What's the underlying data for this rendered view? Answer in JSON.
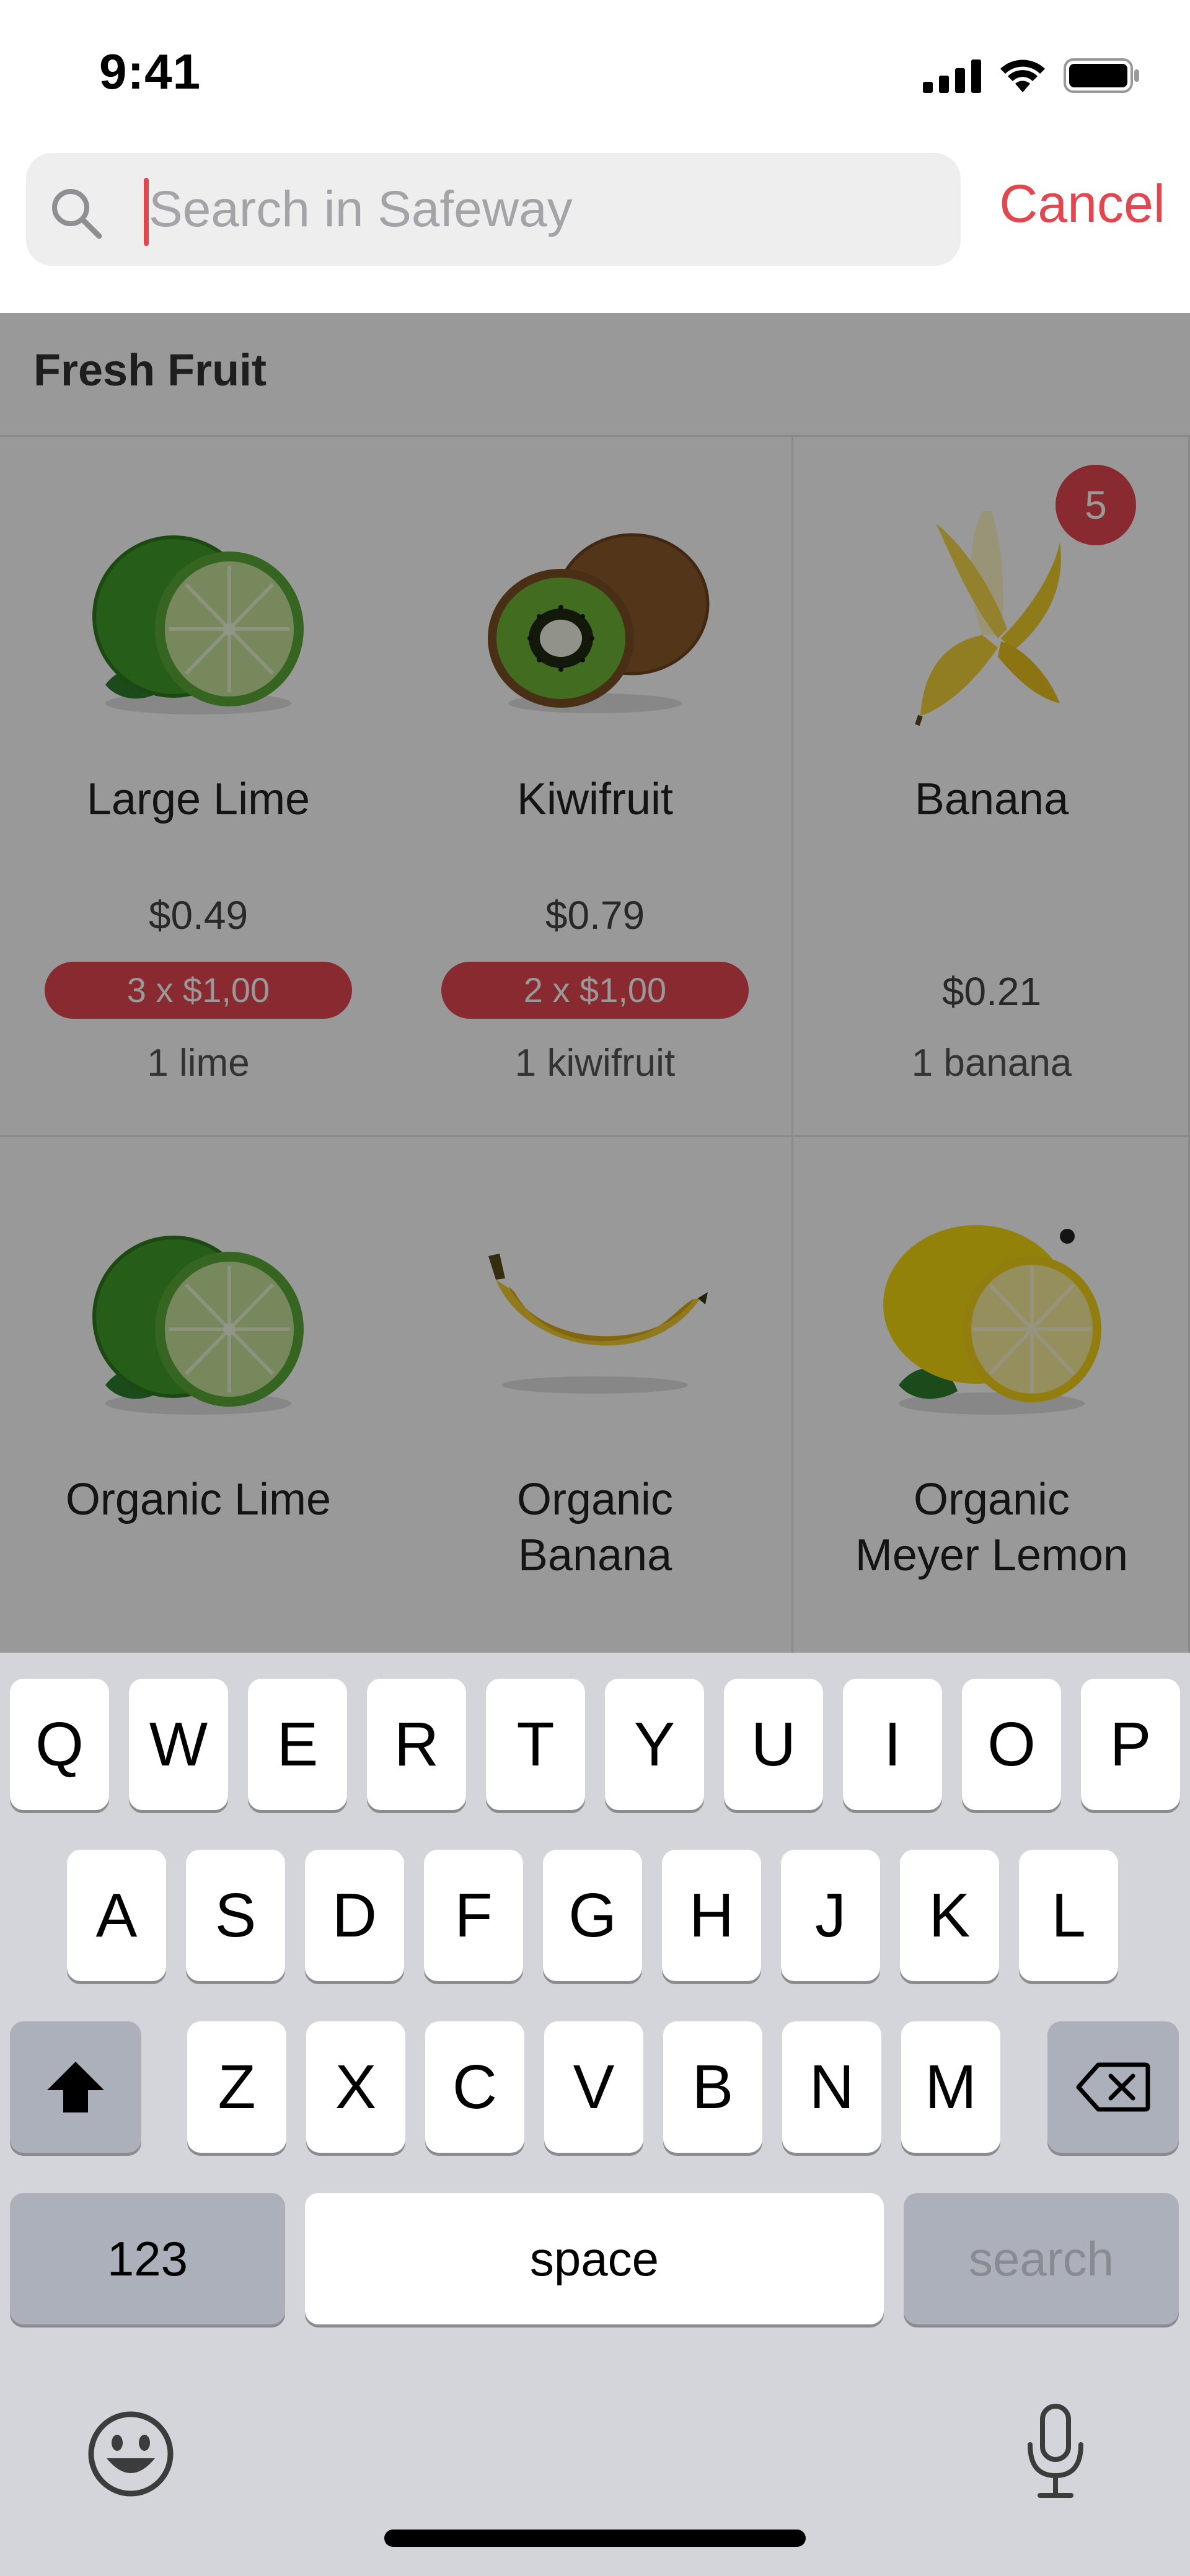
{
  "status_bar": {
    "time": "9:41",
    "icons": [
      "signal-icon",
      "wifi-icon",
      "battery-icon"
    ]
  },
  "search": {
    "placeholder": "Search in Safeway",
    "value": "",
    "cancel_label": "Cancel"
  },
  "section": {
    "title": "Fresh Fruit"
  },
  "products": [
    {
      "name": "Large Lime",
      "price": "$0.49",
      "promo": "3 x $1,00",
      "unit": "1 lime",
      "image": "lime-image"
    },
    {
      "name": "Kiwifruit",
      "price": "$0.79",
      "promo": "2 x $1,00",
      "unit": "1 kiwifruit",
      "image": "kiwi-image"
    },
    {
      "name": "Banana",
      "price": "$0.21",
      "promo": null,
      "unit": "1 banana",
      "image": "banana-image",
      "cart_count": "5"
    },
    {
      "name": "Organic Lime",
      "image": "lime-image"
    },
    {
      "name": "Organic\nBanana",
      "image": "banana-image"
    },
    {
      "name": "Organic\nMeyer Lemon",
      "image": "lemon-image"
    }
  ],
  "keyboard": {
    "row1": [
      "Q",
      "W",
      "E",
      "R",
      "T",
      "Y",
      "U",
      "I",
      "O",
      "P"
    ],
    "row2": [
      "A",
      "S",
      "D",
      "F",
      "G",
      "H",
      "J",
      "K",
      "L"
    ],
    "row3": [
      "Z",
      "X",
      "C",
      "V",
      "B",
      "N",
      "M"
    ],
    "num_label": "123",
    "space_label": "space",
    "search_label": "search"
  },
  "colors": {
    "accent": "#e3464f",
    "keyboard_bg": "#d3d5da",
    "search_bg": "#eeeeef"
  }
}
